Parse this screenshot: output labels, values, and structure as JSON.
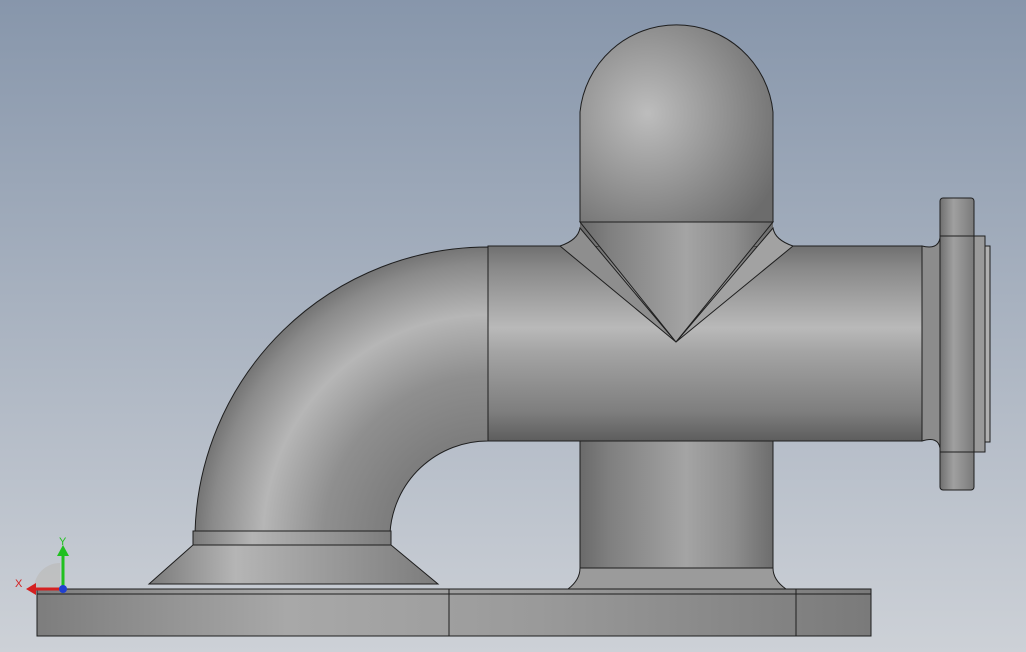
{
  "viewport": {
    "background_top": "#8796ab",
    "background_bottom": "#cdd1d7"
  },
  "model": {
    "base_color": "#9a9a9a",
    "edge_color": "#1e1e1e"
  },
  "triad": {
    "x_label": "X",
    "y_label": "Y",
    "x_color": "#d42020",
    "y_color": "#20c020",
    "z_color": "#2040d0"
  }
}
